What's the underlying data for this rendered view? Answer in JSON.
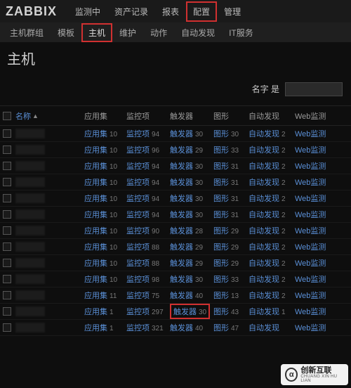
{
  "logo": "ZABBIX",
  "topnav": [
    "监测中",
    "资产记录",
    "报表",
    "配置",
    "管理"
  ],
  "topnav_active": 3,
  "subnav": [
    "主机群组",
    "模板",
    "主机",
    "维护",
    "动作",
    "自动发现",
    "IT服务"
  ],
  "subnav_active": 2,
  "page_title": "主机",
  "filter": {
    "label": "名字 是",
    "value": ""
  },
  "columns": {
    "name": "名称",
    "app": "应用集",
    "mon": "监控项",
    "trig": "触发器",
    "graph": "图形",
    "disc": "自动发现",
    "web": "Web监测"
  },
  "link_labels": {
    "app": "应用集",
    "mon": "监控项",
    "trig": "触发器",
    "graph": "图形",
    "disc": "自动发现",
    "web": "Web监测"
  },
  "rows": [
    {
      "app": 10,
      "mon": 94,
      "trig": 30,
      "graph": 30,
      "disc": 2
    },
    {
      "app": 10,
      "mon": 96,
      "trig": 29,
      "graph": 33,
      "disc": 2
    },
    {
      "app": 10,
      "mon": 94,
      "trig": 30,
      "graph": 31,
      "disc": 2
    },
    {
      "app": 10,
      "mon": 94,
      "trig": 30,
      "graph": 31,
      "disc": 2
    },
    {
      "app": 10,
      "mon": 94,
      "trig": 30,
      "graph": 31,
      "disc": 2
    },
    {
      "app": 10,
      "mon": 94,
      "trig": 30,
      "graph": 31,
      "disc": 2
    },
    {
      "app": 10,
      "mon": 90,
      "trig": 28,
      "graph": 29,
      "disc": 2
    },
    {
      "app": 10,
      "mon": 88,
      "trig": 29,
      "graph": 29,
      "disc": 2
    },
    {
      "app": 10,
      "mon": 88,
      "trig": 29,
      "graph": 29,
      "disc": 2
    },
    {
      "app": 10,
      "mon": 98,
      "trig": 30,
      "graph": 33,
      "disc": 2
    },
    {
      "app": 11,
      "mon": 75,
      "trig": 40,
      "graph": 13,
      "disc": 2
    },
    {
      "app": 1,
      "mon": 297,
      "trig": 30,
      "graph": 43,
      "disc": 1,
      "hl_trig": true
    },
    {
      "app": 1,
      "mon": 321,
      "trig": 40,
      "graph": 47
    }
  ],
  "watermark": {
    "cn": "创新互联",
    "en": "CHUANG XIN HU LIAN",
    "glyph": "α"
  }
}
